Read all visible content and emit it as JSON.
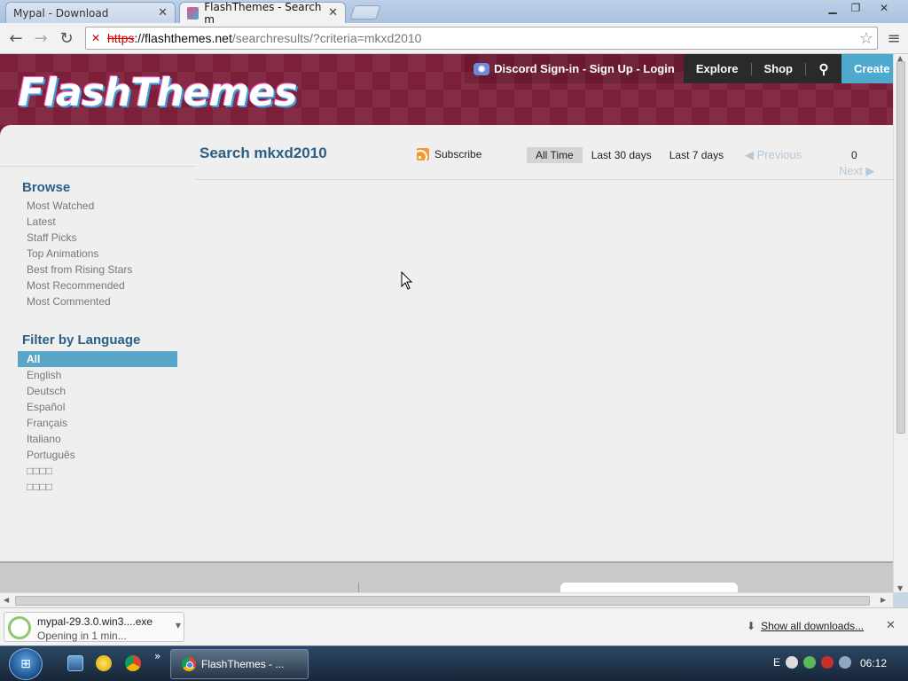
{
  "browser": {
    "tabs": [
      {
        "title": "Mypal - Download",
        "active": false
      },
      {
        "title": "FlashThemes - Search m",
        "active": true
      }
    ],
    "url": {
      "scheme": "https",
      "host": "://flashthemes.net",
      "path": "/searchresults/?criteria=mkxd2010"
    }
  },
  "site": {
    "logo": "FlashThemes",
    "nav": {
      "discord": "Discord Sign-in",
      "signup": "Sign Up",
      "login": "Login",
      "explore": "Explore",
      "shop": "Shop",
      "create": "Create"
    }
  },
  "sidebar": {
    "browse_title": "Browse",
    "browse_items": [
      "Most Watched",
      "Latest",
      "Staff Picks",
      "Top Animations",
      "Best from Rising Stars",
      "Most Recommended",
      "Most Commented"
    ],
    "language_title": "Filter by Language",
    "languages": [
      "All",
      "English",
      "Deutsch",
      "Español",
      "Français",
      "Italiano",
      "Português",
      "□□□□",
      "□□□□"
    ],
    "selected_language": "All"
  },
  "main": {
    "title": "Search mkxd2010",
    "subscribe": "Subscribe",
    "time_filters": [
      "All Time",
      "Last 30 days",
      "Last 7 days"
    ],
    "active_filter": "All Time",
    "previous": "Previous",
    "next": "Next",
    "count": "0"
  },
  "downloads": {
    "filename": "mypal-29.3.0.win3....exe",
    "status": "Opening in 1 min...",
    "show_all": "Show all downloads..."
  },
  "taskbar": {
    "window": "FlashThemes - ...",
    "lang": "E",
    "clock": "06:12"
  },
  "colors": {
    "header_bg": "#7c1f39",
    "accent_blue": "#4ea9cf",
    "title_blue": "#2a5f86",
    "selected_bg": "#5aa6c8"
  }
}
